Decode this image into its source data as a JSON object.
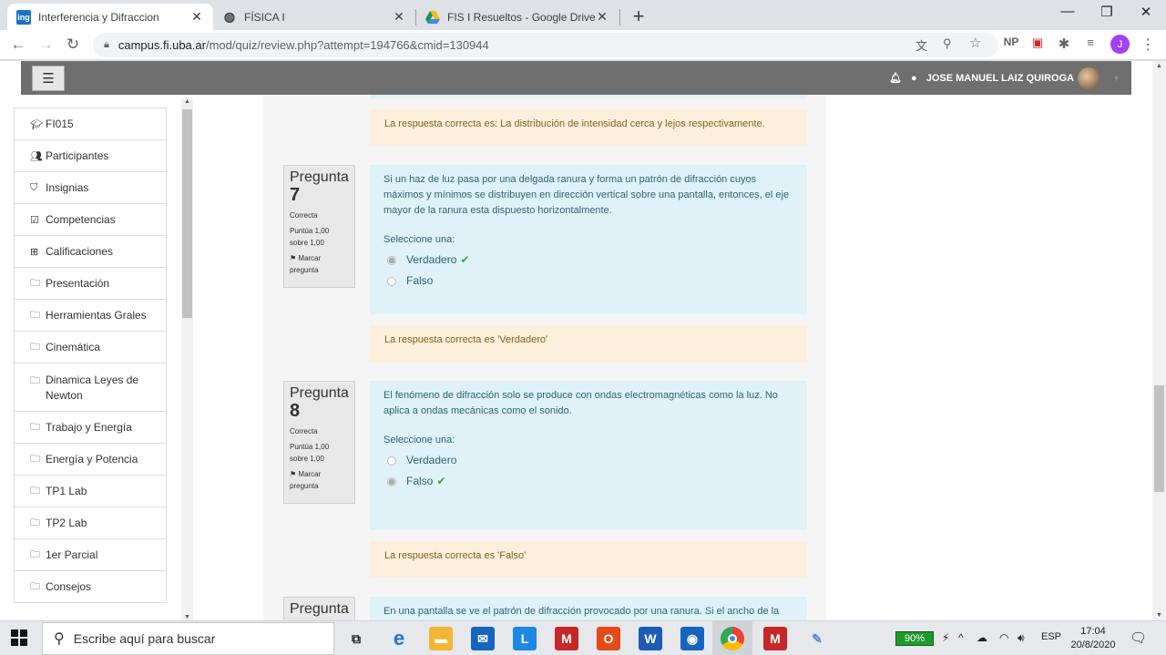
{
  "tabs": [
    {
      "title": "Interferencia y Difraccion",
      "favicon": "ing"
    },
    {
      "title": "FÍSICA I",
      "favicon": ""
    },
    {
      "title": "FIS I Resueltos - Google Drive",
      "favicon": ""
    }
  ],
  "window_controls": {
    "minimize": "—",
    "maximize": "❐",
    "close": "✕"
  },
  "address": {
    "host": "campus.fi.uba.ar",
    "path": "/mod/quiz/review.php?attempt=194766&cmid=130944"
  },
  "extensions": {
    "np": "NP"
  },
  "profile_initial": "J",
  "navbar": {
    "user_name": "JOSE MANUEL LAIZ QUIROGA"
  },
  "drawer": [
    {
      "label": "FI015",
      "icon": "graduation-cap-icon"
    },
    {
      "label": "Participantes",
      "icon": "users-icon"
    },
    {
      "label": "Insignias",
      "icon": "shield-icon"
    },
    {
      "label": "Competencias",
      "icon": "checkbox-icon"
    },
    {
      "label": "Calificaciones",
      "icon": "table-icon"
    },
    {
      "label": "Presentación",
      "icon": "folder-icon"
    },
    {
      "label": "Herramientas Grales",
      "icon": "folder-icon"
    },
    {
      "label": "Cinemática",
      "icon": "folder-icon"
    },
    {
      "label": "Dinamica Leyes de Newton",
      "icon": "folder-icon"
    },
    {
      "label": "Trabajo y Energía",
      "icon": "folder-icon"
    },
    {
      "label": "Energía y Potencia",
      "icon": "folder-icon"
    },
    {
      "label": "TP1 Lab",
      "icon": "folder-icon"
    },
    {
      "label": "TP2 Lab",
      "icon": "folder-icon"
    },
    {
      "label": "1er Parcial",
      "icon": "folder-icon"
    },
    {
      "label": "Consejos",
      "icon": "folder-icon"
    }
  ],
  "quiz": {
    "prev_feedback": "La respuesta correcta es: La distribución de intensidad cerca y lejos respectivamente.",
    "questions": [
      {
        "label": "Pregunta",
        "number": "7",
        "state": "Correcta",
        "grade": "Puntúa 1,00 sobre 1,00",
        "flag": "Marcar pregunta",
        "text": "Si un haz de luz pasa por una delgada ranura y forma un patrón de difracción cuyos máximos y mínimos se distribuyen en dirección vertical sobre una pantalla, entonces, el eje mayor de la ranura esta dispuesto horizontalmente.",
        "prompt": "Seleccione una:",
        "options": [
          {
            "label": "Verdadero",
            "selected": true,
            "correct": true
          },
          {
            "label": "Falso",
            "selected": false,
            "correct": false
          }
        ],
        "feedback": "La respuesta correcta es 'Verdadero'"
      },
      {
        "label": "Pregunta",
        "number": "8",
        "state": "Correcta",
        "grade": "Puntúa 1,00 sobre 1,00",
        "flag": "Marcar pregunta",
        "text": "El fenómeno de difracción solo se produce con ondas electromagnéticas como la luz. No aplica a ondas mecánicas como el sonido.",
        "prompt": "Seleccione una:",
        "options": [
          {
            "label": "Verdadero",
            "selected": false,
            "correct": false
          },
          {
            "label": "Falso",
            "selected": true,
            "correct": true
          }
        ],
        "feedback": "La respuesta correcta es 'Falso'"
      },
      {
        "label": "Pregunta",
        "text": "En una pantalla se ve el patrón de difracción provocado por una ranura. Si el ancho de la"
      }
    ]
  },
  "taskbar": {
    "search_placeholder": "Escribe aquí para buscar",
    "battery": "90%",
    "language": "ESP",
    "time": "17:04",
    "date": "20/8/2020"
  }
}
